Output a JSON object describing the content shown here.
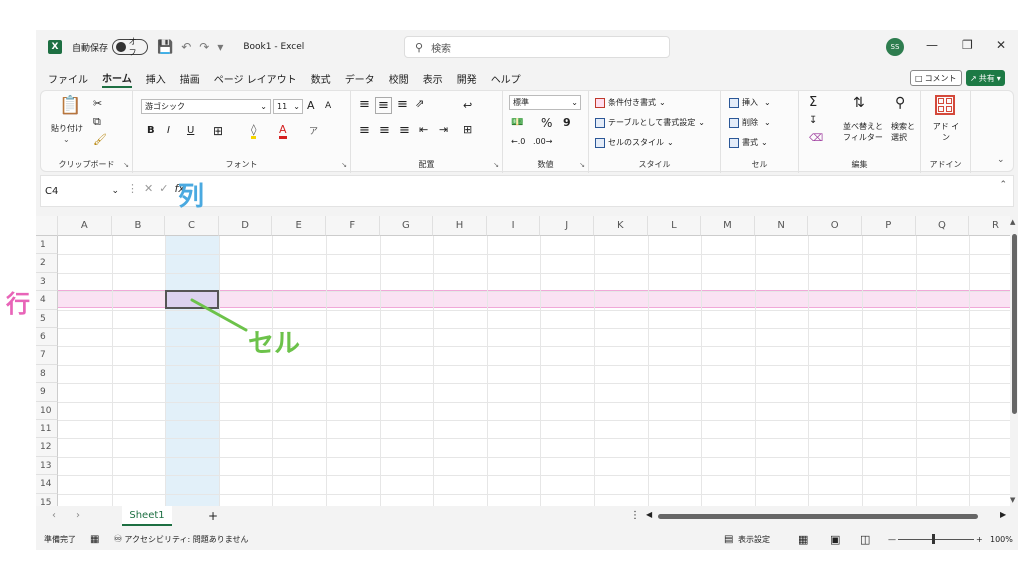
{
  "titlebar": {
    "app_icon": "X",
    "autosave_label": "自動保存",
    "autosave_state": "オフ",
    "document_title": "Book1 - Excel",
    "search_placeholder": "検索",
    "avatar": "SS"
  },
  "tabs": [
    "ファイル",
    "ホーム",
    "挿入",
    "描画",
    "ページ レイアウト",
    "数式",
    "データ",
    "校閲",
    "表示",
    "開発",
    "ヘルプ"
  ],
  "active_tab": "ホーム",
  "comment_label": "コメント",
  "share_label": "共有",
  "ribbon": {
    "clipboard": {
      "paste": "貼り付け",
      "label": "クリップボード"
    },
    "font": {
      "name": "游ゴシック",
      "size": "11",
      "bold": "B",
      "italic": "I",
      "underline": "U",
      "grow": "A",
      "shrink": "A",
      "label": "フォント"
    },
    "alignment": {
      "label": "配置"
    },
    "number": {
      "format": "標準",
      "percent": "%",
      "comma": "9",
      "label": "数値"
    },
    "styles": {
      "conditional": "条件付き書式",
      "as_table": "テーブルとして書式設定",
      "cell_styles": "セルのスタイル",
      "label": "スタイル"
    },
    "cells": {
      "insert": "挿入",
      "delete": "削除",
      "format": "書式",
      "label": "セル"
    },
    "editing": {
      "sum": "Σ",
      "sort": "並べ替えと フィルター",
      "find": "検索と 選択",
      "label": "編集"
    },
    "addins": {
      "addin": "アド イン",
      "label": "アドイン"
    }
  },
  "formula_bar": {
    "name_box": "C4",
    "fx": "fx",
    "value": ""
  },
  "columns": [
    "A",
    "B",
    "C",
    "D",
    "E",
    "F",
    "G",
    "H",
    "I",
    "J",
    "K",
    "L",
    "M",
    "N",
    "O",
    "P",
    "Q",
    "R"
  ],
  "rows": [
    "1",
    "2",
    "3",
    "4",
    "5",
    "6",
    "7",
    "8",
    "9",
    "10",
    "11",
    "12",
    "13",
    "14",
    "15"
  ],
  "sheet": {
    "name": "Sheet1",
    "add": "+"
  },
  "status": {
    "ready": "準備完了",
    "accessibility": "アクセシビリティ: 問題ありません",
    "display_settings": "表示設定",
    "zoom": "100%"
  },
  "annotations": {
    "column": "列",
    "row": "行",
    "cell": "セル"
  },
  "colors": {
    "excel_green": "#1d6f42",
    "column_annotation": "#4aa9e0",
    "row_annotation": "#e864b8",
    "cell_annotation": "#6cc24a"
  }
}
